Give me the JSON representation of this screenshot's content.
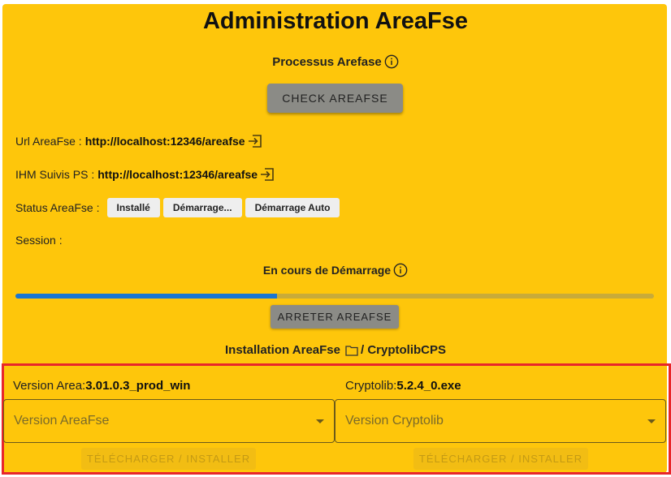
{
  "page": {
    "title": "Administration AreaFse",
    "process_label": "Processus Arefase",
    "check_button": "CHECK AREAFSE"
  },
  "info": {
    "url_label": "Url AreaFse :",
    "url_value": "http://localhost:12346/areafse",
    "ihm_label": "IHM Suivis PS :",
    "ihm_value": "http://localhost:12346/areafse",
    "status_label": "Status AreaFse :",
    "status_chips": [
      "Installé",
      "Démarrage...",
      "Démarrage Auto"
    ],
    "session_label": "Session :"
  },
  "progress": {
    "label": "En cours de Démarrage",
    "value_percent": 41,
    "stop_button": "ARRETER AREAFSE",
    "fill_color": "#1976d2"
  },
  "installation": {
    "title_left": "Installation AreaFse",
    "title_right": "/ CryptolibCPS",
    "area": {
      "version_label": "Version Area:",
      "version_value": "3.01.0.3_prod_win",
      "select_placeholder": "Version AreaFse",
      "install_button": "TÉLÉCHARGER / INSTALLER"
    },
    "crypto": {
      "version_label": "Cryptolib:",
      "version_value": "5.2.4_0.exe",
      "select_placeholder": "Version Cryptolib",
      "install_button": "TÉLÉCHARGER / INSTALLER"
    }
  },
  "colors": {
    "panel_bg": "#fec60b",
    "highlight_border": "#e8262a",
    "button_gray": "#8b8b86"
  },
  "icons": {
    "info": "info-circle-icon",
    "link": "login-arrow-icon",
    "folder": "folder-icon",
    "dropdown": "caret-down-icon"
  }
}
